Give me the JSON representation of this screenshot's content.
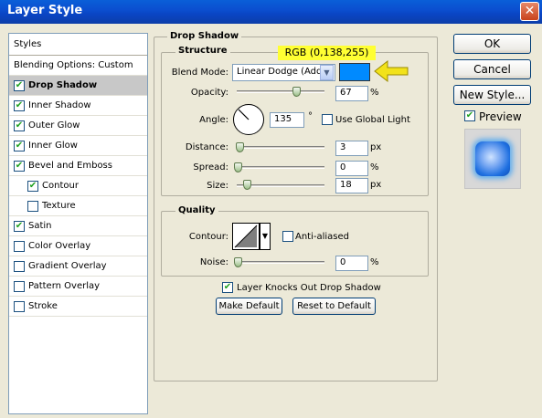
{
  "window": {
    "title": "Layer Style",
    "close_glyph": "✕"
  },
  "styles_panel": {
    "header": "Styles",
    "items": [
      {
        "label": "Blending Options: Custom",
        "checkbox": false,
        "checked": false,
        "selected": false,
        "indent": false
      },
      {
        "label": "Drop Shadow",
        "checkbox": true,
        "checked": true,
        "selected": true,
        "indent": false
      },
      {
        "label": "Inner Shadow",
        "checkbox": true,
        "checked": true,
        "selected": false,
        "indent": false
      },
      {
        "label": "Outer Glow",
        "checkbox": true,
        "checked": true,
        "selected": false,
        "indent": false
      },
      {
        "label": "Inner Glow",
        "checkbox": true,
        "checked": true,
        "selected": false,
        "indent": false
      },
      {
        "label": "Bevel and Emboss",
        "checkbox": true,
        "checked": true,
        "selected": false,
        "indent": false
      },
      {
        "label": "Contour",
        "checkbox": true,
        "checked": true,
        "selected": false,
        "indent": true
      },
      {
        "label": "Texture",
        "checkbox": true,
        "checked": false,
        "selected": false,
        "indent": true
      },
      {
        "label": "Satin",
        "checkbox": true,
        "checked": true,
        "selected": false,
        "indent": false
      },
      {
        "label": "Color Overlay",
        "checkbox": true,
        "checked": false,
        "selected": false,
        "indent": false
      },
      {
        "label": "Gradient Overlay",
        "checkbox": true,
        "checked": false,
        "selected": false,
        "indent": false
      },
      {
        "label": "Pattern Overlay",
        "checkbox": true,
        "checked": false,
        "selected": false,
        "indent": false
      },
      {
        "label": "Stroke",
        "checkbox": true,
        "checked": false,
        "selected": false,
        "indent": false
      }
    ]
  },
  "drop_shadow": {
    "title": "Drop Shadow",
    "structure": {
      "title": "Structure",
      "blend_mode_label": "Blend Mode:",
      "blend_mode_value": "Linear Dodge (Add)",
      "swatch_color": "#008aff",
      "annotation": "RGB (0,138,255)",
      "annotation_bg": "#ffff33",
      "arrow_color": "#f2e21a",
      "opacity_label": "Opacity:",
      "opacity_value": "67",
      "opacity_pct": 67,
      "opacity_unit": "%",
      "angle_label": "Angle:",
      "angle_value": "135",
      "angle_unit": "°",
      "use_global_light_label": "Use Global Light",
      "use_global_light": false,
      "distance_label": "Distance:",
      "distance_value": "3",
      "distance_unit": "px",
      "spread_label": "Spread:",
      "spread_value": "0",
      "spread_unit": "%",
      "size_label": "Size:",
      "size_value": "18",
      "size_unit": "px"
    },
    "quality": {
      "title": "Quality",
      "contour_label": "Contour:",
      "anti_aliased_label": "Anti-aliased",
      "anti_aliased": false,
      "noise_label": "Noise:",
      "noise_value": "0",
      "noise_unit": "%"
    },
    "knocks_out_label": "Layer Knocks Out Drop Shadow",
    "knocks_out": true,
    "make_default_label": "Make Default",
    "reset_default_label": "Reset to Default"
  },
  "buttons": {
    "ok": "OK",
    "cancel": "Cancel",
    "new_style": "New Style...",
    "preview_label": "Preview",
    "preview_checked": true
  },
  "colors": {
    "title_bar": "#0a4fd0",
    "dialog_bg": "#ece9d8",
    "preview_glow": "#1e6fe0"
  }
}
